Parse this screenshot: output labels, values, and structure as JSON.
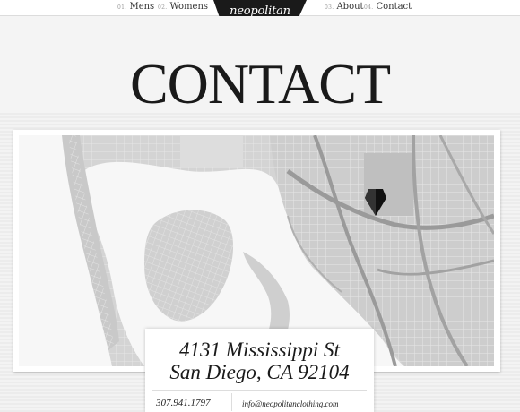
{
  "nav": {
    "items": [
      {
        "num": "01.",
        "label": "Mens"
      },
      {
        "num": "02.",
        "label": "Womens"
      },
      {
        "num": "03.",
        "label": "About"
      },
      {
        "num": "04.",
        "label": "Contact"
      }
    ],
    "logo_text": "neopolitan"
  },
  "page": {
    "title": "CONTACT"
  },
  "address": {
    "line1": "4131 Mississippi St",
    "line2": "San Diego, CA 92104",
    "phone": "307.941.1797",
    "email": "info@neopolitanclothing.com"
  },
  "colors": {
    "logo_bg": "#1a1a1a",
    "map_water": "#f7f7f7",
    "map_land": "#d4d4d4",
    "marker": "#111111"
  },
  "icons": {
    "marker": "map-pin-icon"
  }
}
